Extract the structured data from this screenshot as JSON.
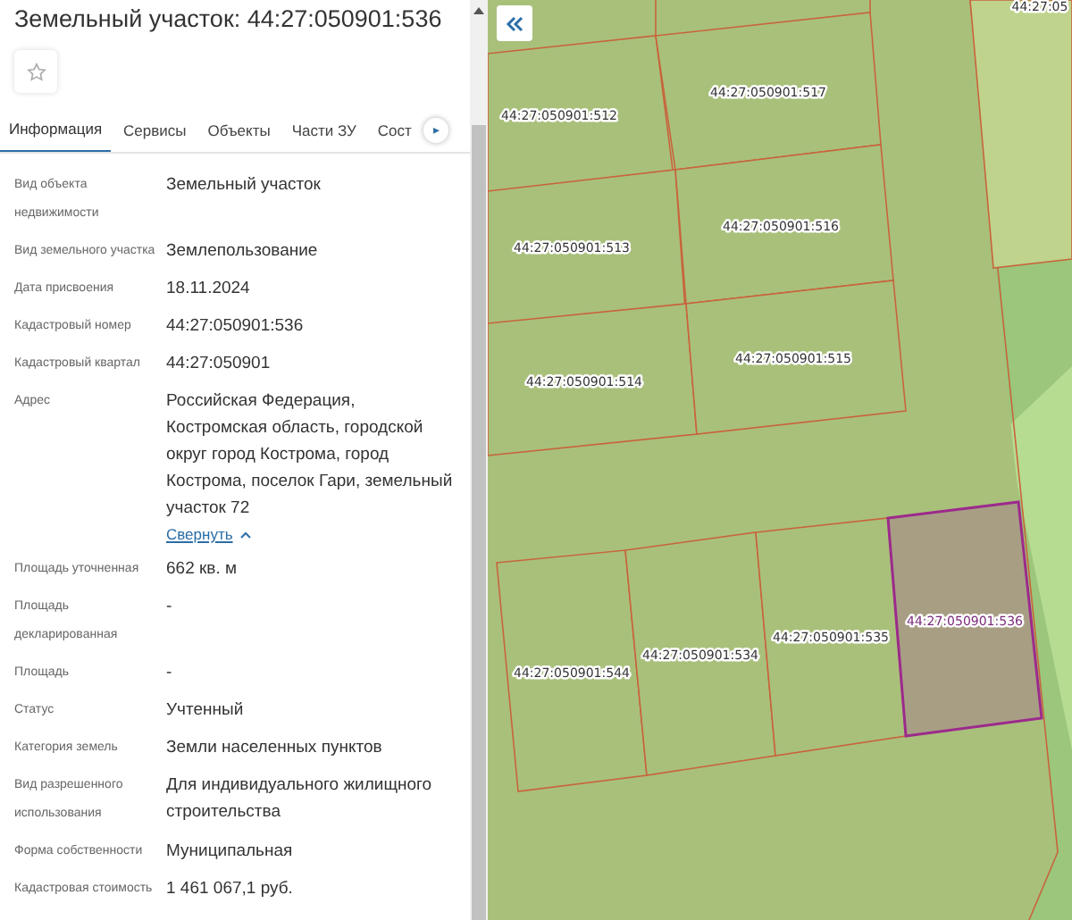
{
  "title": "Земельный участок: 44:27:050901:536",
  "favorite": {
    "starred": false
  },
  "tabs": [
    {
      "label": "Информация",
      "selected": true
    },
    {
      "label": "Сервисы",
      "selected": false
    },
    {
      "label": "Объекты",
      "selected": false
    },
    {
      "label": "Части ЗУ",
      "selected": false
    },
    {
      "label": "Сост",
      "selected": false
    }
  ],
  "tab_scroll": "▸",
  "properties": [
    {
      "label": "Вид объекта недвижимости",
      "value": "Земельный участок"
    },
    {
      "label": "Вид земельного участка",
      "value": "Землепользование"
    },
    {
      "label": "Дата присвоения",
      "value": "18.11.2024"
    },
    {
      "label": "Кадастровый номер",
      "value": "44:27:050901:536"
    },
    {
      "label": "Кадастровый квартал",
      "value": "44:27:050901"
    },
    {
      "label": "Адрес",
      "value": "Российская Федерация, Костромская область, городской округ город Кострома, город Кострома, поселок Гари, земельный участок 72",
      "link": "Свернуть"
    },
    {
      "label": "Площадь уточненная",
      "value": "662 кв. м"
    },
    {
      "label": "Площадь декларированная",
      "value": "-"
    },
    {
      "label": "Площадь",
      "value": "-"
    },
    {
      "label": "Статус",
      "value": "Учтенный"
    },
    {
      "label": "Категория земель",
      "value": "Земли населенных пунктов"
    },
    {
      "label": "Вид разрешенного использования",
      "value": "Для индивидуального жилищного строительства"
    },
    {
      "label": "Форма собственности",
      "value": "Муниципальная"
    },
    {
      "label": "Кадастровая стоимость",
      "value": "1 461 067,1 руб."
    }
  ],
  "map": {
    "parcels": [
      {
        "label": "44:27:050901:512",
        "selected": false
      },
      {
        "label": "44:27:050901:517",
        "selected": false
      },
      {
        "label": "44:27:050901:513",
        "selected": false
      },
      {
        "label": "44:27:050901:516",
        "selected": false
      },
      {
        "label": "44:27:050901:514",
        "selected": false
      },
      {
        "label": "44:27:050901:515",
        "selected": false
      },
      {
        "label": "44:27:050901:544",
        "selected": false
      },
      {
        "label": "44:27:050901:534",
        "selected": false
      },
      {
        "label": "44:27:050901:535",
        "selected": false
      },
      {
        "label": "44:27:050901:536",
        "selected": true
      },
      {
        "label": "44:27:05",
        "selected": false
      }
    ]
  }
}
